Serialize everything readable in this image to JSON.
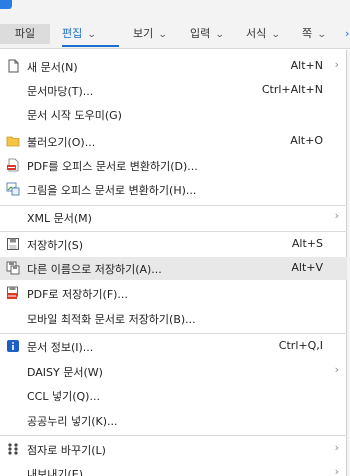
{
  "menubar": {
    "tabs": [
      {
        "label": "파일"
      },
      {
        "label": "편집"
      },
      {
        "label": "보기"
      },
      {
        "label": "입력"
      },
      {
        "label": "서식"
      },
      {
        "label": "쪽"
      }
    ],
    "accent_color": "#1b6fd1"
  },
  "menu": {
    "items": [
      {
        "label": "새 문서(N)",
        "shortcut": "Alt+N",
        "icon": "new-document-icon",
        "submenu": true
      },
      {
        "label": "문서마당(T)...",
        "shortcut": "Ctrl+Alt+N",
        "icon": "",
        "submenu": false
      },
      {
        "label": "문서 시작 도우미(G)",
        "shortcut": "",
        "icon": "",
        "submenu": false
      },
      {
        "label": "불러오기(O)...",
        "shortcut": "Alt+O",
        "icon": "open-folder-icon",
        "submenu": false
      },
      {
        "label": "PDF를 오피스 문서로 변환하기(D)...",
        "shortcut": "",
        "icon": "pdf-convert-icon",
        "submenu": false
      },
      {
        "label": "그림을 오피스 문서로 변환하기(H)...",
        "shortcut": "",
        "icon": "image-convert-icon",
        "submenu": false
      },
      {
        "label": "XML 문서(M)",
        "shortcut": "",
        "icon": "",
        "submenu": true
      },
      {
        "label": "저장하기(S)",
        "shortcut": "Alt+S",
        "icon": "save-icon",
        "submenu": false
      },
      {
        "label": "다른 이름으로 저장하기(A)...",
        "shortcut": "Alt+V",
        "icon": "save-as-icon",
        "submenu": false,
        "highlighted": true
      },
      {
        "label": "PDF로 저장하기(F)...",
        "shortcut": "",
        "icon": "pdf-save-icon",
        "submenu": false
      },
      {
        "label": "모바일 최적화 문서로 저장하기(B)...",
        "shortcut": "",
        "icon": "",
        "submenu": false
      },
      {
        "label": "문서 정보(I)...",
        "shortcut": "Ctrl+Q,I",
        "icon": "info-icon",
        "submenu": false
      },
      {
        "label": "DAISY 문서(W)",
        "shortcut": "",
        "icon": "",
        "submenu": true
      },
      {
        "label": "CCL 넣기(Q)...",
        "shortcut": "",
        "icon": "",
        "submenu": false
      },
      {
        "label": "공공누리 넣기(K)...",
        "shortcut": "",
        "icon": "",
        "submenu": false
      },
      {
        "label": "점자로 바꾸기(L)",
        "shortcut": "",
        "icon": "braille-icon",
        "submenu": true
      },
      {
        "label": "내보내기(E)",
        "shortcut": "",
        "icon": "",
        "submenu": true
      }
    ],
    "submenu_glyph": "›",
    "chevron_glyph": "⌄"
  }
}
